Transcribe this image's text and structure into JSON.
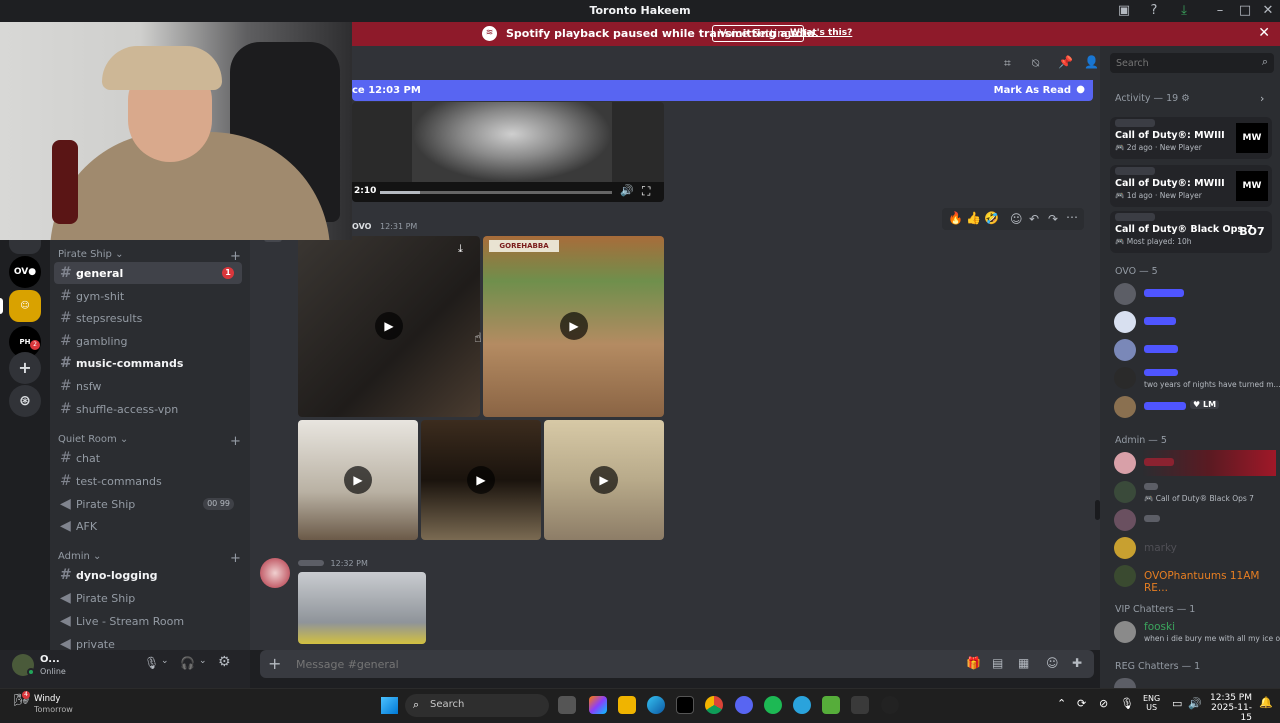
{
  "window": {
    "title": "Toronto Hakeem"
  },
  "banner": {
    "text": "Spotify playback paused while transmitting audio.",
    "button": "Voice Settings",
    "link": "What's this?"
  },
  "server": {
    "categories": [
      {
        "name": "Pirate Ship",
        "channels": [
          {
            "name": "general",
            "type": "text",
            "state": "active",
            "badge": "1"
          },
          {
            "name": "gym-shit",
            "type": "text",
            "state": "read"
          },
          {
            "name": "stepsresults",
            "type": "text",
            "state": "read"
          },
          {
            "name": "gambling",
            "type": "text",
            "state": "read"
          },
          {
            "name": "music-commands",
            "type": "text",
            "state": "unread"
          },
          {
            "name": "nsfw",
            "type": "text",
            "state": "read"
          },
          {
            "name": "shuffle-access-vpn",
            "type": "text",
            "state": "read"
          }
        ]
      },
      {
        "name": "Quiet Room",
        "channels": [
          {
            "name": "chat",
            "type": "text",
            "state": "read"
          },
          {
            "name": "test-commands",
            "type": "text",
            "state": "read"
          },
          {
            "name": "Pirate Ship",
            "type": "voice",
            "state": "read",
            "counts": "00 99"
          },
          {
            "name": "AFK",
            "type": "voice",
            "state": "read"
          }
        ]
      },
      {
        "name": "Admin",
        "channels": [
          {
            "name": "dyno-logging",
            "type": "text",
            "state": "unread"
          },
          {
            "name": "Pirate Ship",
            "type": "voice",
            "state": "read"
          },
          {
            "name": "Live - Stream Room",
            "type": "voice",
            "state": "read"
          },
          {
            "name": "private",
            "type": "voice",
            "state": "read"
          }
        ]
      }
    ]
  },
  "user": {
    "name": "O...",
    "status": "Online"
  },
  "new_messages": {
    "since": "ce 12:03 PM",
    "mark": "Mark As Read"
  },
  "messages": [
    {
      "author": "OVO",
      "time": "12:31 PM"
    },
    {
      "author": "",
      "time": "12:32 PM"
    }
  ],
  "video": {
    "time": "2:10"
  },
  "composer": {
    "placeholder": "Message #general"
  },
  "search": {
    "placeholder": "Search"
  },
  "activity": {
    "header": "Activity — 19",
    "items": [
      {
        "game": "Call of Duty®: MWIII",
        "ago": "2d ago",
        "tag": "New Player",
        "logo": "MW"
      },
      {
        "game": "Call of Duty®: MWIII",
        "ago": "1d ago",
        "tag": "New Player",
        "logo": "MW"
      },
      {
        "game": "Call of Duty® Black Ops 7",
        "ago": "",
        "tag": "Most played: 10h",
        "logo": "BO7"
      }
    ]
  },
  "member_sections": [
    {
      "title": "OVO — 5",
      "members": [
        {
          "name": "",
          "sub": ""
        },
        {
          "name": "",
          "sub": ""
        },
        {
          "name": "",
          "sub": ""
        },
        {
          "name": "",
          "sub": "two years of nights have turned m..."
        },
        {
          "name": "",
          "sub": "",
          "tag": "LM"
        }
      ]
    },
    {
      "title": "Admin — 5",
      "members": [
        {
          "name": "",
          "sub": ""
        },
        {
          "name": "",
          "sub": "Call of Duty® Black Ops 7"
        },
        {
          "name": "",
          "sub": ""
        },
        {
          "name": "marky",
          "sub": ""
        },
        {
          "name": "OVOPhantuums 11AM RE...",
          "sub": "",
          "color": "#e67e22"
        }
      ]
    },
    {
      "title": "VIP Chatters — 1",
      "members": [
        {
          "name": "fooski",
          "sub": "when i die bury me with all my ice on",
          "color": "#3ba55d"
        }
      ]
    },
    {
      "title": "REG Chatters — 1",
      "members": []
    }
  ],
  "taskbar": {
    "weather": {
      "title": "Windy",
      "sub": "Tomorrow"
    },
    "search": "Search",
    "lang": "ENG",
    "region": "US",
    "time": "12:35 PM",
    "date": "2025-11-15"
  }
}
